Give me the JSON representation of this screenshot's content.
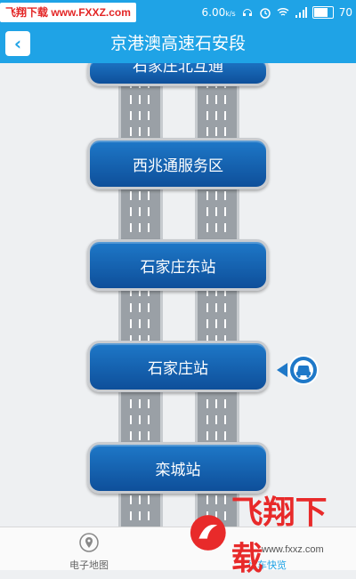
{
  "status_bar": {
    "watermark": "飞翔下载 www.FXXZ.com",
    "speed": "6.00",
    "speed_unit": "k/s",
    "battery": "70"
  },
  "header": {
    "back_glyph": "‹",
    "title": "京港澳高速石安段"
  },
  "stations": [
    {
      "name": "石家庄北互通"
    },
    {
      "name": "西兆通服务区"
    },
    {
      "name": "石家庄东站"
    },
    {
      "name": "石家庄站"
    },
    {
      "name": "栾城站"
    }
  ],
  "current_station_index": 3,
  "bottom_nav": {
    "items": [
      {
        "label": "电子地图",
        "icon": "map-pin-icon",
        "active": false
      },
      {
        "label": "行车快览",
        "icon": "car-icon",
        "active": true
      }
    ]
  },
  "watermark_logo": {
    "text": "飞翔下载",
    "sub": "www.fxxz.com"
  },
  "colors": {
    "accent": "#1fa3e6",
    "station_button": "#0e4f9a",
    "road": "#9aa0a6"
  }
}
